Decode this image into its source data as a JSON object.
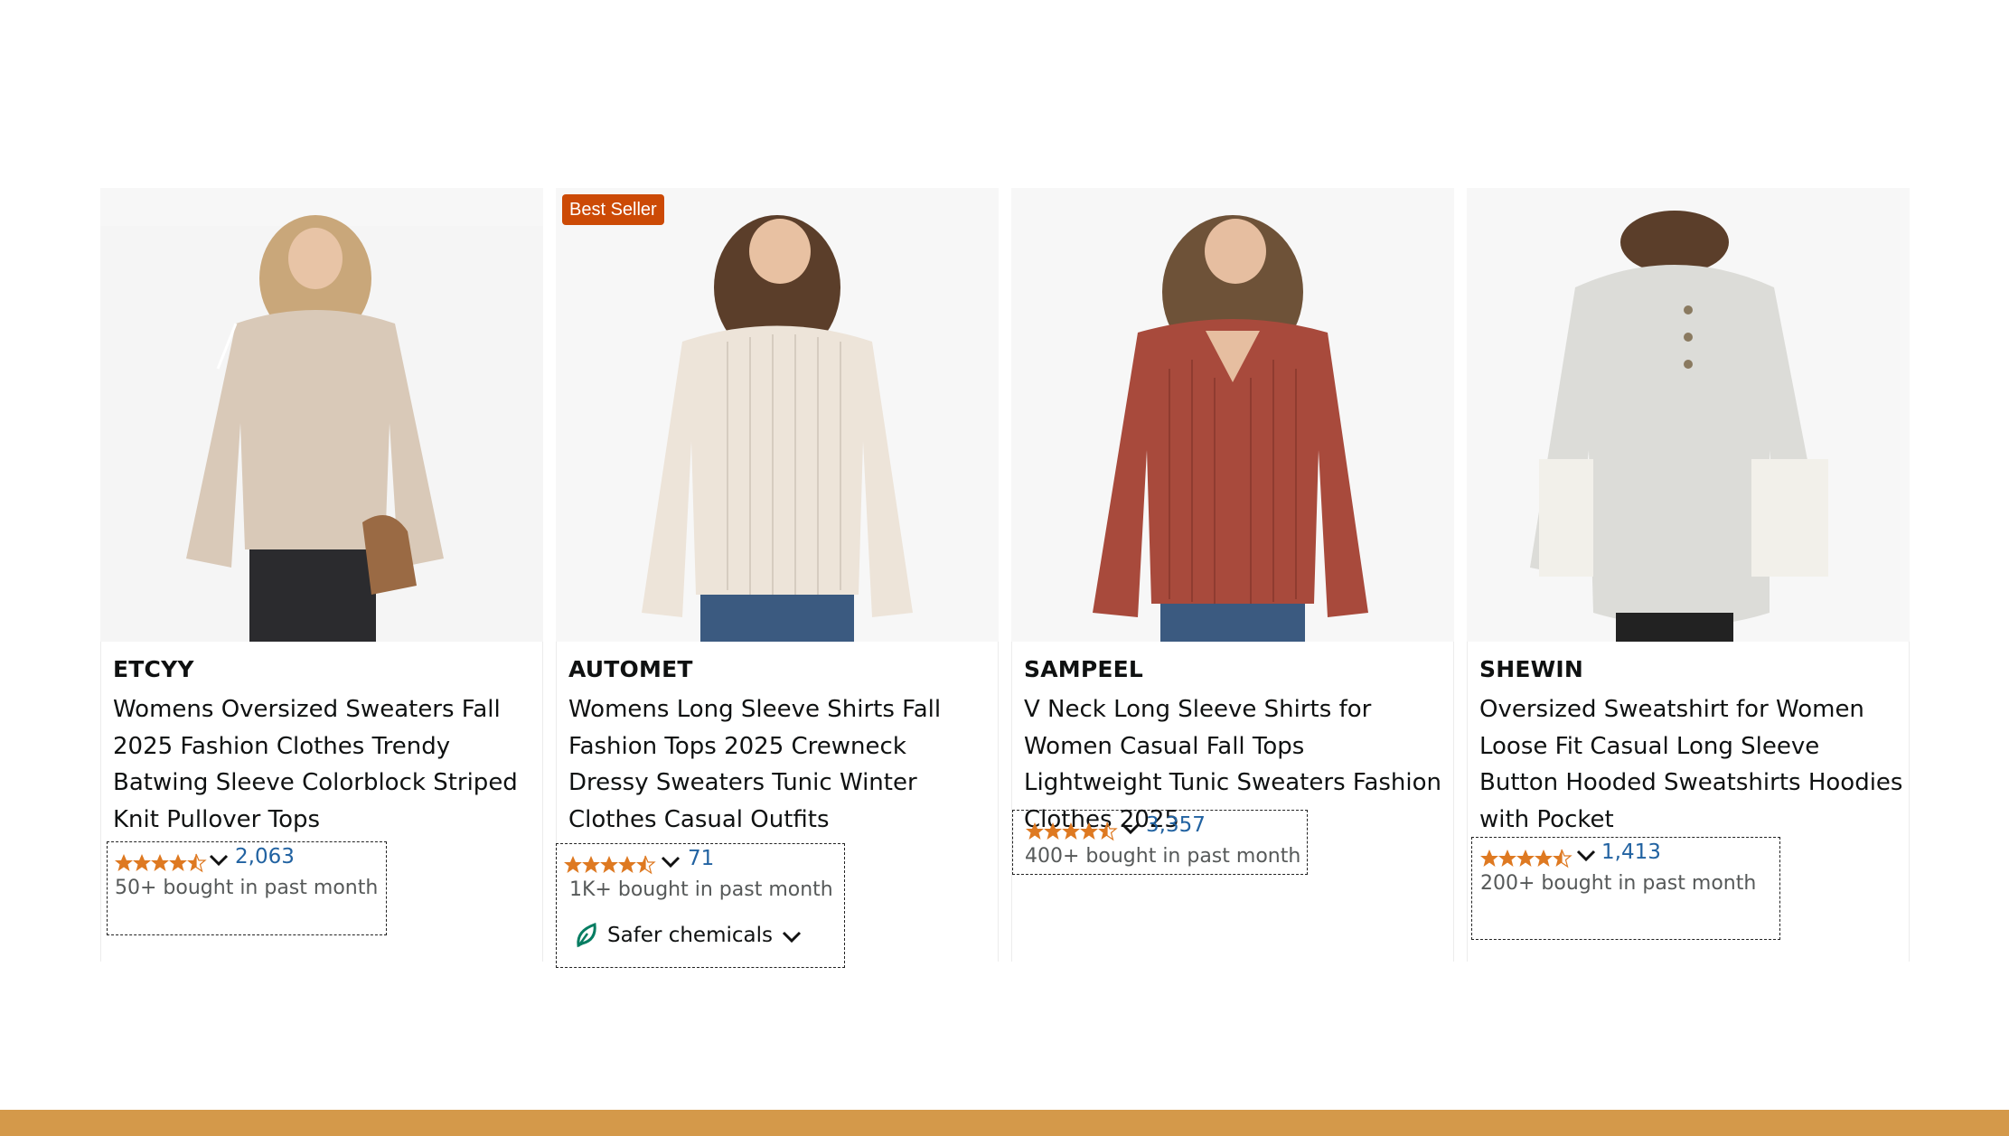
{
  "products": [
    {
      "brand": "ETCYY",
      "title": "Womens Oversized Sweaters Fall 2025 Fashion Clothes Trendy Batwing Sleeve Colorblock Striped Knit Pullover Tops",
      "rating_stars": 4.5,
      "rating_count": "2,063",
      "bought": "50+ bought in past month",
      "sweater_color": "#d9c9b8"
    },
    {
      "badge": "Best Seller",
      "brand": "AUTOMET",
      "title": "Womens Long Sleeve Shirts Fall Fashion Tops 2025 Crewneck Dressy Sweaters Tunic Winter Clothes Casual Outfits",
      "rating_stars": 4.5,
      "rating_count": "71",
      "bought": "1K+ bought in past month",
      "safer": "Safer chemicals",
      "sweater_color": "#ede4d9"
    },
    {
      "brand": "SAMPEEL",
      "title": "V Neck Long Sleeve Shirts for Women Casual Fall Tops Lightweight Tunic Sweaters Fashion Clothes 2025",
      "rating_stars": 4.5,
      "rating_count": "3,357",
      "bought": "400+ bought in past month",
      "sweater_color": "#a84a3c"
    },
    {
      "brand": "SHEWIN",
      "title": "Oversized Sweatshirt for Women Loose Fit Casual Long Sleeve Button Hooded Sweatshirts Hoodies with Pocket",
      "rating_stars": 4.5,
      "rating_count": "1,413",
      "bought": "200+ bought in past month",
      "sweater_color": "#dcdcd8"
    }
  ],
  "colors": {
    "badge": "#cc4a06",
    "link": "#2162a1",
    "star": "#de7921",
    "footer_bar": "#d4994a",
    "leaf": "#067d62"
  }
}
